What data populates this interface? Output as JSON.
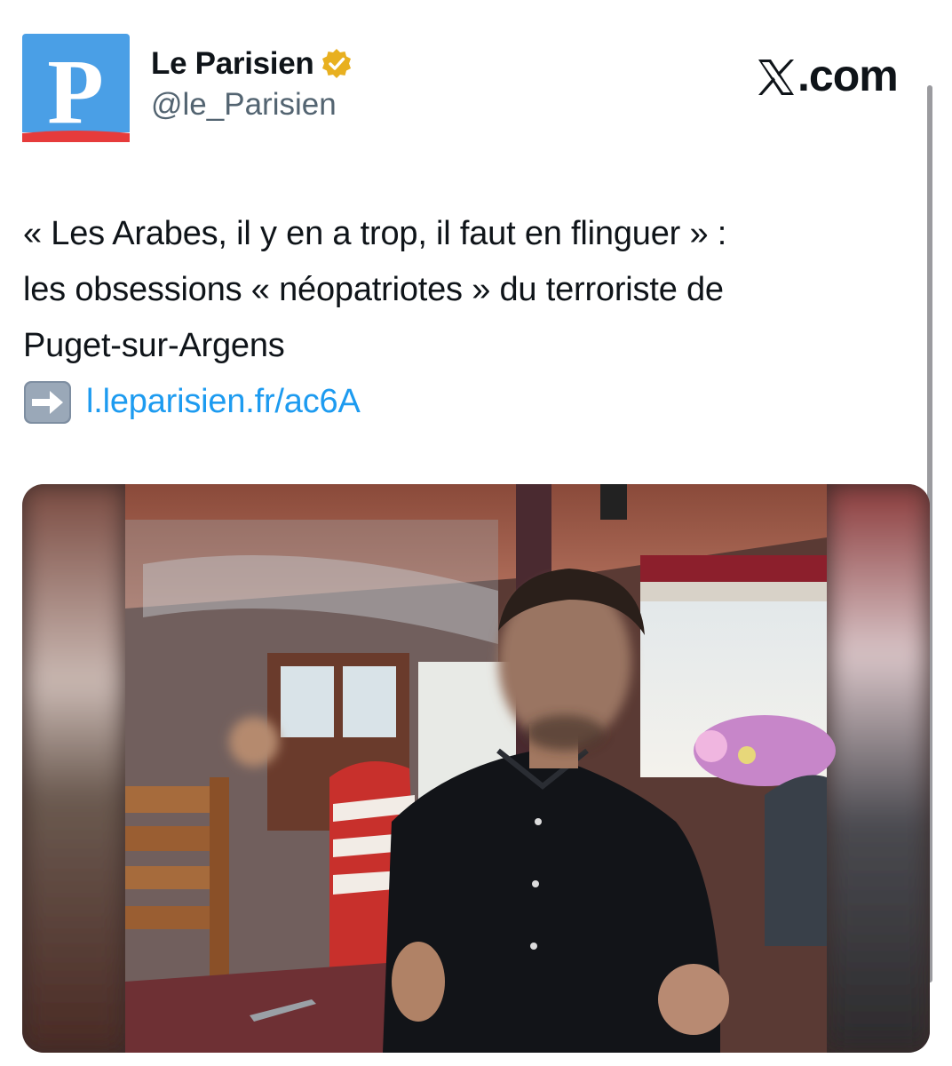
{
  "author": {
    "display_name": "Le Parisien",
    "handle": "@le_Parisien",
    "avatar_letter": "P",
    "verified": true,
    "avatar_color": "#4a9fe6",
    "avatar_stripe_color": "#e63b3b",
    "verified_color": "#e8b020"
  },
  "platform": {
    "label": ".com",
    "icon": "x-logo-icon"
  },
  "tweet": {
    "lines": [
      "« Les Arabes, il y en a trop, il faut en flinguer » :",
      "les obsessions « néopatriotes » du terroriste de",
      "Puget-sur-Argens"
    ],
    "link_icon": "right-arrow-emoji-icon",
    "link_text": "l.leparisien.fr/ac6A",
    "link_color": "#1d9bf0"
  },
  "media": {
    "type": "photo",
    "subject": "man-in-black-shirt-at-restaurant-table-blurred-face"
  }
}
